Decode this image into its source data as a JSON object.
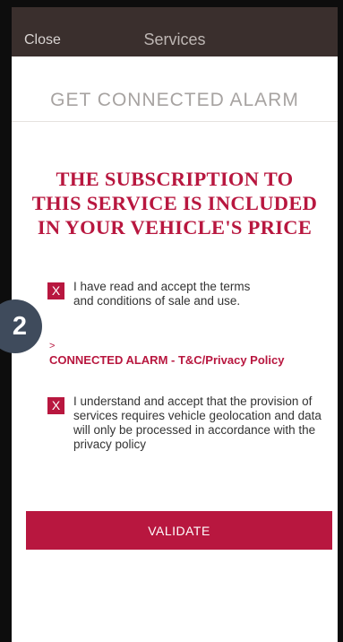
{
  "navbar": {
    "close_label": "Close",
    "title": "Services"
  },
  "page": {
    "heading": "GET CONNECTED ALARM",
    "headline_lines": [
      "THE SUBSCRIPTION TO",
      "THIS SERVICE IS INCLUDED",
      "IN YOUR VEHICLE'S PRICE"
    ]
  },
  "terms": {
    "checkbox_mark": "X",
    "line1": "I have read and accept the terms",
    "line2": "and conditions of sale and use."
  },
  "step_badge": "2",
  "policy": {
    "arrow": ">",
    "link_label": "CONNECTED ALARM - T&C/Privacy Policy"
  },
  "geolocation": {
    "checkbox_mark": "X",
    "line1": "I understand and accept that the provision of",
    "line2": "services requires vehicle geolocation and data",
    "line3": "will only be processed in accordance with the",
    "line4": "privacy policy"
  },
  "actions": {
    "validate_label": "VALIDATE"
  },
  "colors": {
    "accent": "#b8173f",
    "navbar": "#3a2f2d",
    "badge": "#3f4b5c"
  }
}
